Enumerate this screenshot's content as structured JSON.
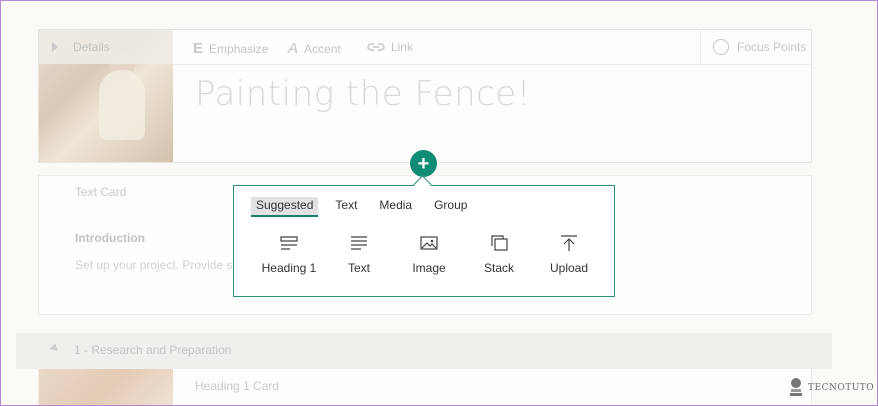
{
  "details": {
    "label": "Details"
  },
  "toolbar": {
    "emphasize": "Emphasize",
    "accent": "Accent",
    "link": "Link",
    "focus_points": "Focus Points"
  },
  "page_title": "Painting the Fence!",
  "text_card": {
    "label": "Text Card",
    "intro": "Introduction",
    "body": "Set up your project. Provide s"
  },
  "section": {
    "label": "1 - Research and Preparation"
  },
  "heading1_card": {
    "label": "Heading 1 Card"
  },
  "popup": {
    "tabs": [
      {
        "label": "Suggested",
        "active": true
      },
      {
        "label": "Text"
      },
      {
        "label": "Media"
      },
      {
        "label": "Group"
      }
    ],
    "items": [
      {
        "label": "Heading 1",
        "icon": "heading-icon"
      },
      {
        "label": "Text",
        "icon": "text-lines-icon"
      },
      {
        "label": "Image",
        "icon": "image-icon"
      },
      {
        "label": "Stack",
        "icon": "stack-icon"
      },
      {
        "label": "Upload",
        "icon": "upload-icon"
      }
    ]
  },
  "colors": {
    "accent": "#0f8b76",
    "popup_border": "#2f8d7b"
  },
  "watermark": {
    "label": "TECNOTUTO"
  }
}
